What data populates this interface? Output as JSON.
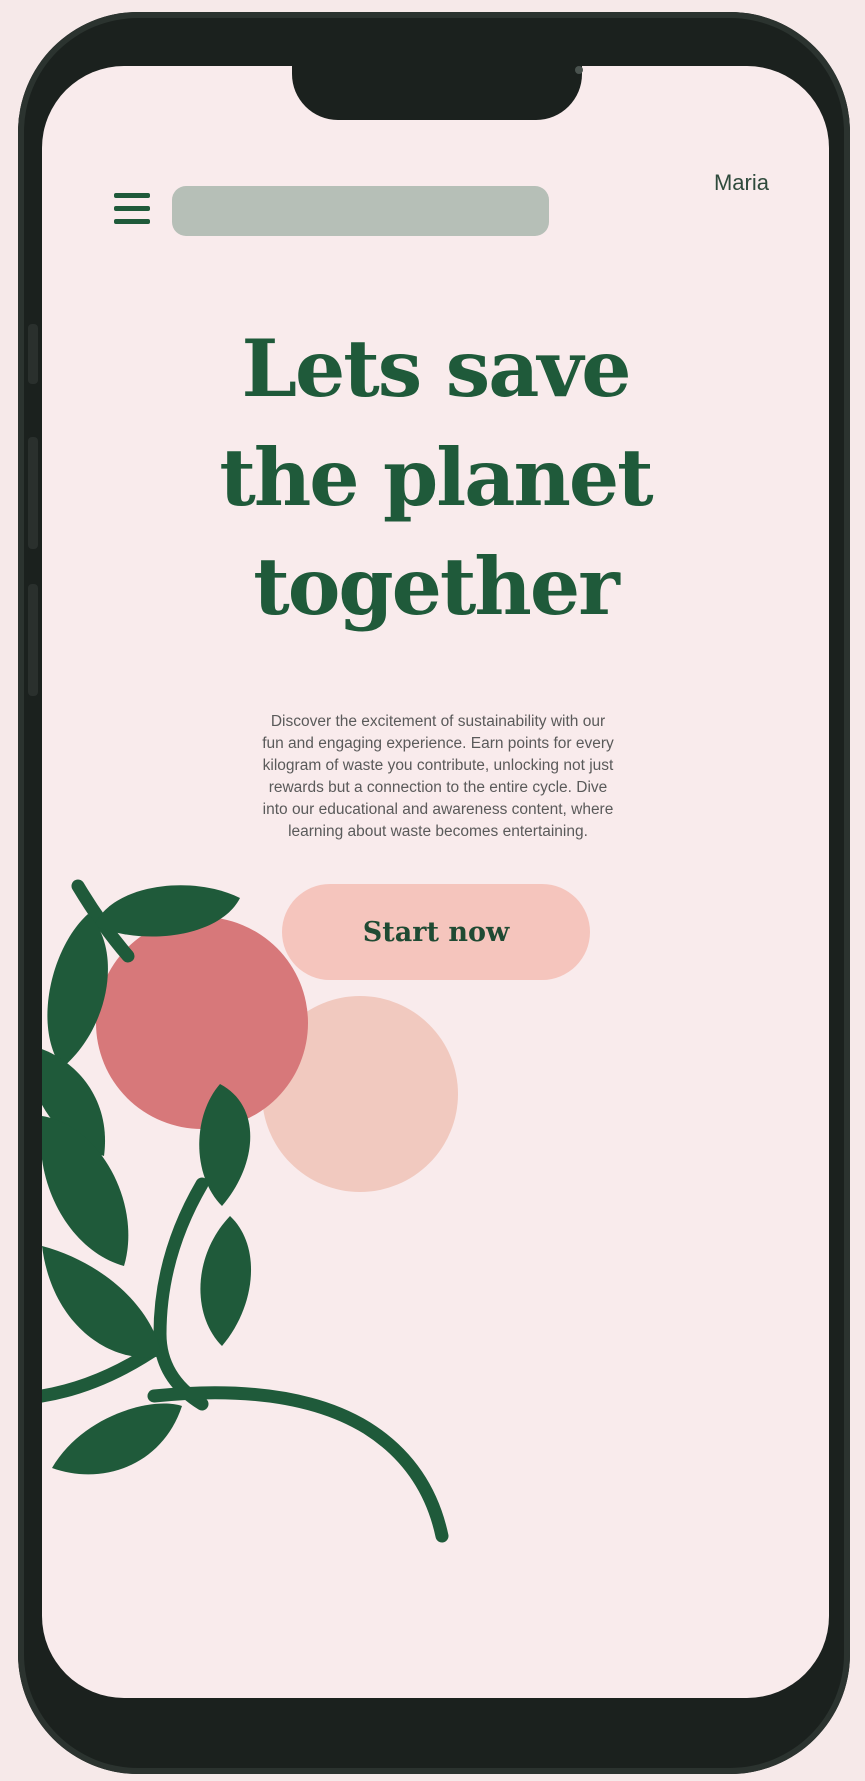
{
  "header": {
    "user_name": "Maria"
  },
  "hero": {
    "title_lines": [
      "Lets save",
      "the planet",
      "together"
    ],
    "description_lines": [
      "Discover the excitement of sustainability with our",
      "fun and engaging experience. Earn points for every",
      "kilogram of waste you contribute, unlocking not just",
      "rewards but a connection to the entire cycle. Dive",
      "into our educational and awareness content, where",
      "learning about waste becomes entertaining."
    ],
    "cta_label": "Start now"
  },
  "colors": {
    "brand_green": "#1f5a3a",
    "background": "#f9ebec",
    "cta_background": "#f5c5bd",
    "coral": "#d7787a",
    "peach": "#f1c9bf",
    "phone_frame": "#1b211e"
  },
  "icons": {
    "menu": "hamburger-menu-icon"
  }
}
